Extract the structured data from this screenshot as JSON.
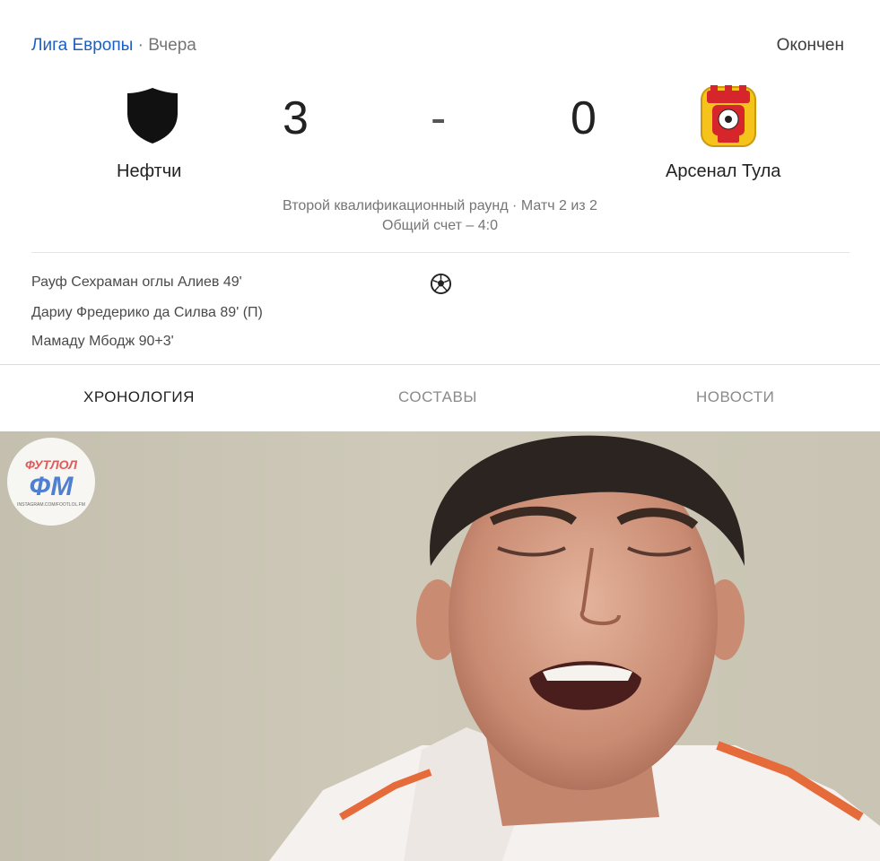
{
  "match": {
    "league": "Лига Европы",
    "separator": "·",
    "when": "Вчера",
    "status": "Окончен",
    "home": {
      "name": "Нефтчи",
      "score": "3",
      "crest": "black-shield-icon"
    },
    "dash": "-",
    "away": {
      "name": "Арсенал Тула",
      "score": "0",
      "crest": "arsenal-tula-crest"
    },
    "round_line1": "Второй квалификационный раунд · Матч 2 из 2",
    "round_line2": "Общий счет – 4:0",
    "scorers": [
      "Рауф Сехраман оглы Алиев 49'",
      "Дариу Фредерико да Силва 89' (П)",
      "Мамаду Мбодж 90+3'"
    ]
  },
  "tabs": [
    "ХРОНОЛОГИЯ",
    "СОСТАВЫ",
    "НОВОСТИ"
  ],
  "watermark": {
    "top": "ФУТЛОЛ",
    "main": "ФМ",
    "sub": "INSTAGRAM.COM/FOOTLOL.FM"
  },
  "colors": {
    "link": "#1a5fc4",
    "muted": "#757575",
    "arsenal_red": "#d6262b",
    "arsenal_yellow": "#f6c31b"
  }
}
